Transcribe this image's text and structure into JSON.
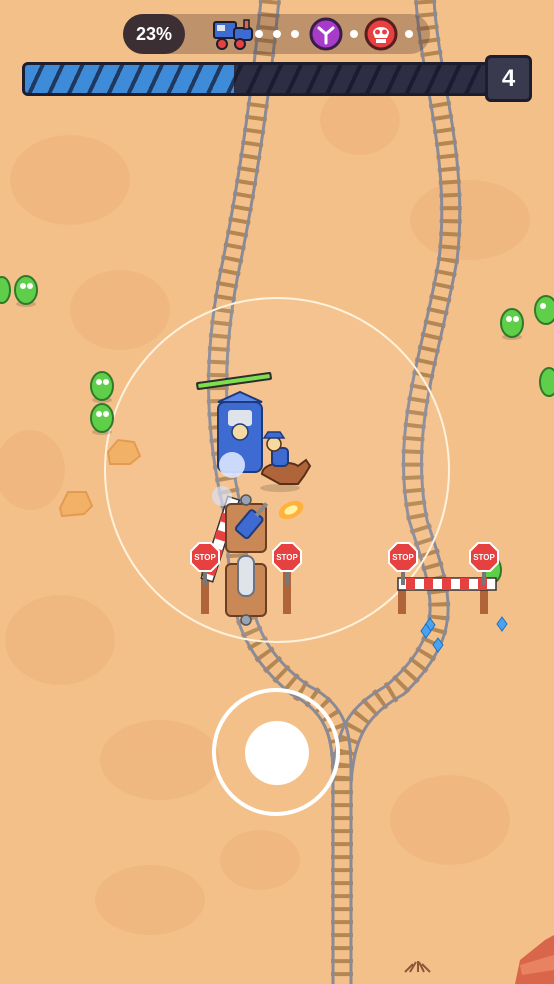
{
  "hud": {
    "progress_text": "23%",
    "progress": 0.23,
    "stage_icons": [
      "locomotive-icon",
      "purple-boss-icon",
      "red-skull-icon"
    ],
    "wave_fill": 0.45,
    "level": "4"
  },
  "stop_signs": [
    "STOP",
    "STOP",
    "STOP",
    "STOP"
  ],
  "colors": {
    "sand": "#f4c08a",
    "rail": "#8a8a96",
    "tie": "#b48652",
    "enemy": "#5fcf4a",
    "wave": "#3d8bd9"
  }
}
